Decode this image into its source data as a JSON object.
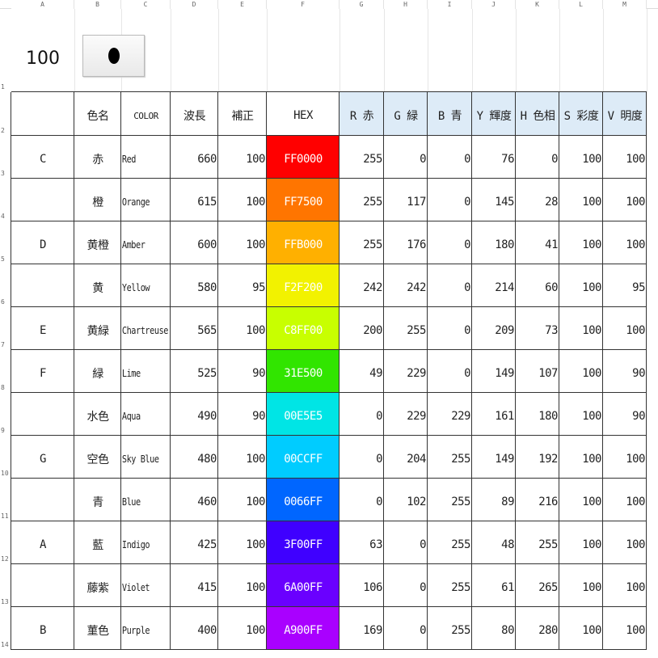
{
  "columns": [
    "A",
    "B",
    "C",
    "D",
    "E",
    "F",
    "G",
    "H",
    "I",
    "J",
    "K",
    "L",
    "M"
  ],
  "row_numbers": [
    "1",
    "2",
    "3",
    "4",
    "5",
    "6",
    "7",
    "8",
    "9",
    "10",
    "11",
    "12",
    "13",
    "14"
  ],
  "top": {
    "value": "100",
    "button_icon": "black-circle-icon"
  },
  "headers": [
    "色名",
    "COLOR",
    "波長",
    "補正",
    "HEX",
    "R 赤",
    "G 緑",
    "B 青",
    "Y 輝度",
    "H 色相",
    "S 彩度",
    "V 明度"
  ],
  "header_fill": "#DDEBF7",
  "rows": [
    {
      "key": "C",
      "jp": "赤",
      "en": "Red",
      "wl": "660",
      "corr": "100",
      "hex": "FF0000",
      "r": "255",
      "g": "0",
      "b": "0",
      "y": "76",
      "h": "0",
      "s": "100",
      "v": "100",
      "fill": "#FF0000",
      "text_color": "#ffffff"
    },
    {
      "key": "",
      "jp": "橙",
      "en": "Orange",
      "wl": "615",
      "corr": "100",
      "hex": "FF7500",
      "r": "255",
      "g": "117",
      "b": "0",
      "y": "145",
      "h": "28",
      "s": "100",
      "v": "100",
      "fill": "#FF7500",
      "text_color": "#ffffff"
    },
    {
      "key": "D",
      "jp": "黄橙",
      "en": "Amber",
      "wl": "600",
      "corr": "100",
      "hex": "FFB000",
      "r": "255",
      "g": "176",
      "b": "0",
      "y": "180",
      "h": "41",
      "s": "100",
      "v": "100",
      "fill": "#FFB000",
      "text_color": "#ffffff"
    },
    {
      "key": "",
      "jp": "黄",
      "en": "Yellow",
      "wl": "580",
      "corr": "95",
      "hex": "F2F200",
      "r": "242",
      "g": "242",
      "b": "0",
      "y": "214",
      "h": "60",
      "s": "100",
      "v": "95",
      "fill": "#F2F200",
      "text_color": "#ffffff"
    },
    {
      "key": "E",
      "jp": "黄緑",
      "en": "Chartreuse",
      "wl": "565",
      "corr": "100",
      "hex": "C8FF00",
      "r": "200",
      "g": "255",
      "b": "0",
      "y": "209",
      "h": "73",
      "s": "100",
      "v": "100",
      "fill": "#C8FF00",
      "text_color": "#ffffff"
    },
    {
      "key": "F",
      "jp": "緑",
      "en": "Lime",
      "wl": "525",
      "corr": "90",
      "hex": "31E500",
      "r": "49",
      "g": "229",
      "b": "0",
      "y": "149",
      "h": "107",
      "s": "100",
      "v": "90",
      "fill": "#31E500",
      "text_color": "#ffffff"
    },
    {
      "key": "",
      "jp": "水色",
      "en": "Aqua",
      "wl": "490",
      "corr": "90",
      "hex": "00E5E5",
      "r": "0",
      "g": "229",
      "b": "229",
      "y": "161",
      "h": "180",
      "s": "100",
      "v": "90",
      "fill": "#00E5E5",
      "text_color": "#ffffff"
    },
    {
      "key": "G",
      "jp": "空色",
      "en": "Sky Blue",
      "wl": "480",
      "corr": "100",
      "hex": "00CCFF",
      "r": "0",
      "g": "204",
      "b": "255",
      "y": "149",
      "h": "192",
      "s": "100",
      "v": "100",
      "fill": "#00CCFF",
      "text_color": "#ffffff"
    },
    {
      "key": "",
      "jp": "青",
      "en": "Blue",
      "wl": "460",
      "corr": "100",
      "hex": "0066FF",
      "r": "0",
      "g": "102",
      "b": "255",
      "y": "89",
      "h": "216",
      "s": "100",
      "v": "100",
      "fill": "#0066FF",
      "text_color": "#ffffff"
    },
    {
      "key": "A",
      "jp": "藍",
      "en": "Indigo",
      "wl": "425",
      "corr": "100",
      "hex": "3F00FF",
      "r": "63",
      "g": "0",
      "b": "255",
      "y": "48",
      "h": "255",
      "s": "100",
      "v": "100",
      "fill": "#3F00FF",
      "text_color": "#ffffff"
    },
    {
      "key": "",
      "jp": "藤紫",
      "en": "Violet",
      "wl": "415",
      "corr": "100",
      "hex": "6A00FF",
      "r": "106",
      "g": "0",
      "b": "255",
      "y": "61",
      "h": "265",
      "s": "100",
      "v": "100",
      "fill": "#6A00FF",
      "text_color": "#ffffff"
    },
    {
      "key": "B",
      "jp": "菫色",
      "en": "Purple",
      "wl": "400",
      "corr": "100",
      "hex": "A900FF",
      "r": "169",
      "g": "0",
      "b": "255",
      "y": "80",
      "h": "280",
      "s": "100",
      "v": "100",
      "fill": "#A900FF",
      "text_color": "#ffffff"
    }
  ]
}
